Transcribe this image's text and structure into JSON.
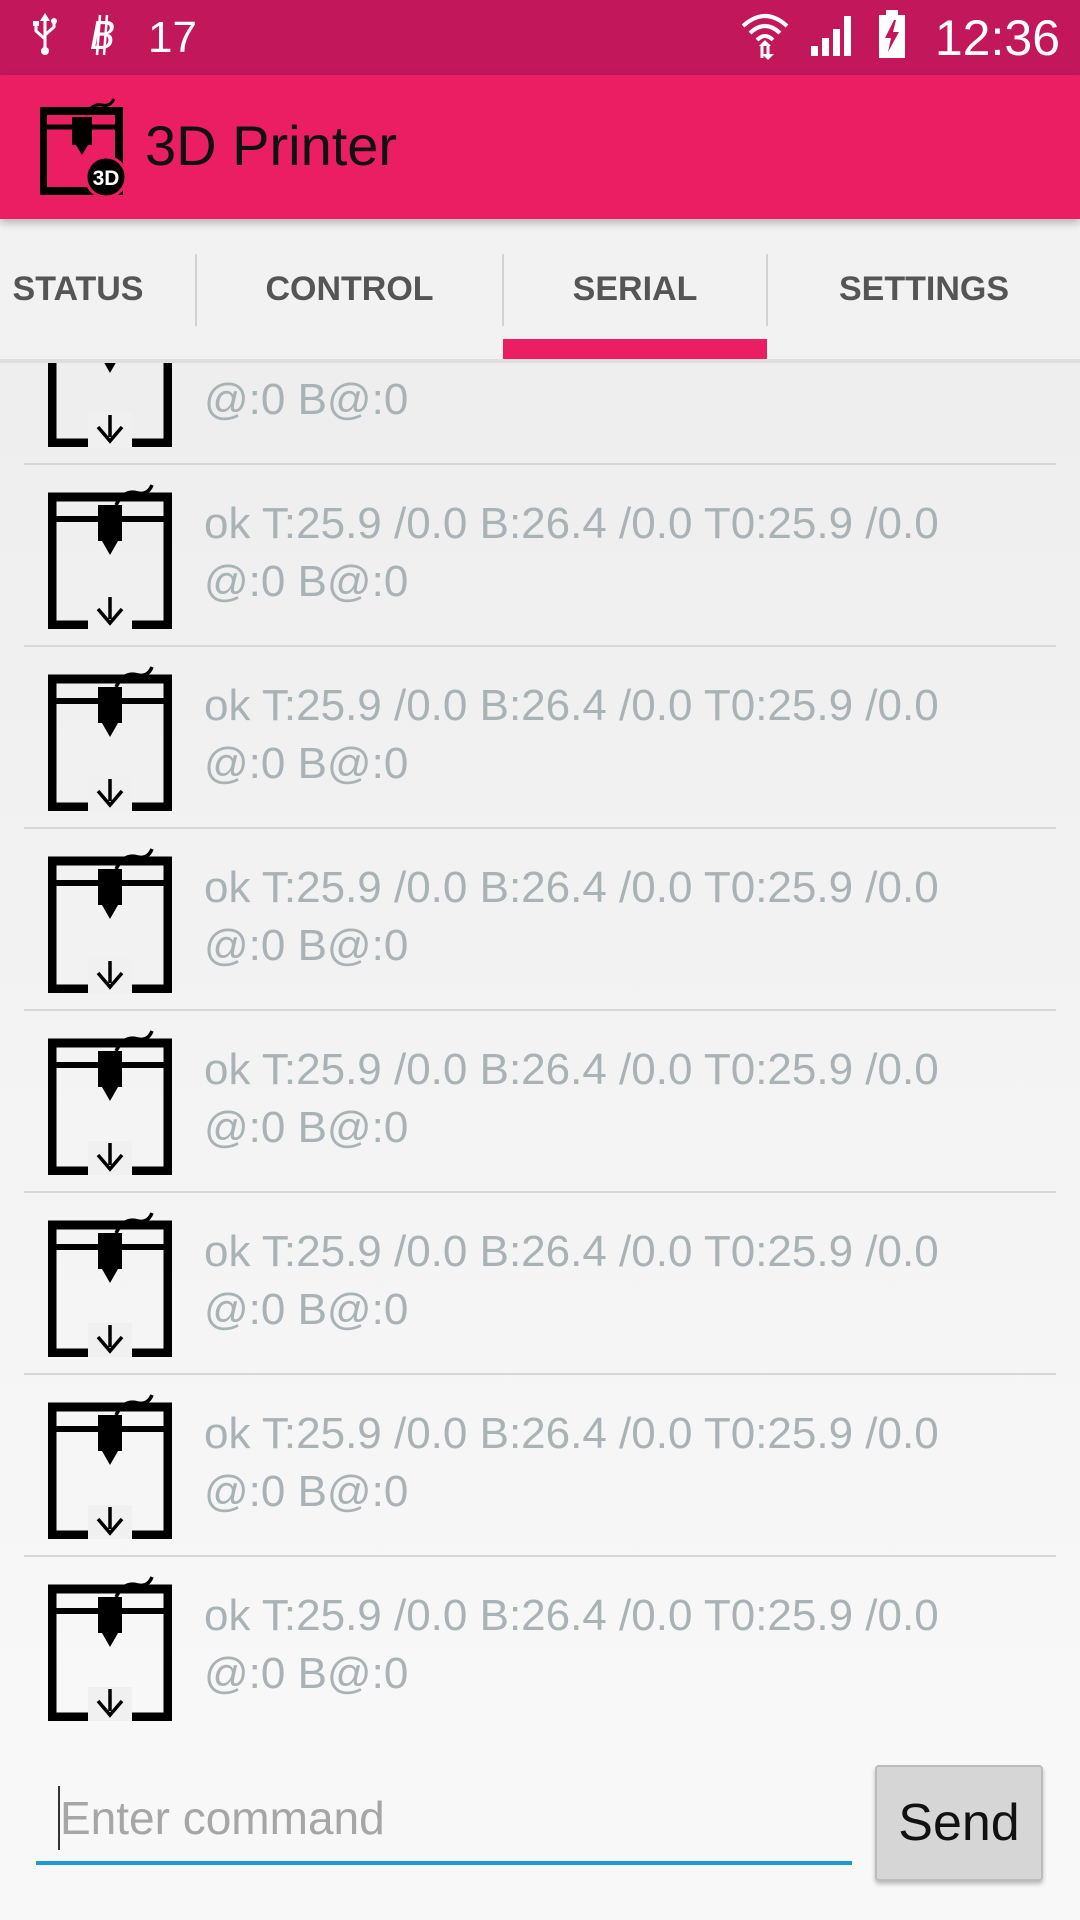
{
  "status_bar": {
    "notification_count": "17",
    "time": "12:36",
    "icons": [
      "usb-icon",
      "bitcoin-icon",
      "wifi-icon",
      "signal-icon",
      "battery-charging-icon"
    ]
  },
  "app_bar": {
    "title": "3D Printer",
    "logo_badge": "3D"
  },
  "tabs": [
    {
      "label": "STATUS"
    },
    {
      "label": "CONTROL"
    },
    {
      "label": "SERIAL"
    },
    {
      "label": "SETTINGS"
    }
  ],
  "active_tab": "SERIAL",
  "log": {
    "partial_first_line": "@:0 B@:0",
    "entries": [
      {
        "line1": "ok T:25.9 /0.0 B:26.4 /0.0 T0:25.9 /0.0",
        "line2": "@:0 B@:0"
      },
      {
        "line1": "ok T:25.9 /0.0 B:26.4 /0.0 T0:25.9 /0.0",
        "line2": "@:0 B@:0"
      },
      {
        "line1": "ok T:25.9 /0.0 B:26.4 /0.0 T0:25.9 /0.0",
        "line2": "@:0 B@:0"
      },
      {
        "line1": "ok T:25.9 /0.0 B:26.4 /0.0 T0:25.9 /0.0",
        "line2": "@:0 B@:0"
      },
      {
        "line1": "ok T:25.9 /0.0 B:26.4 /0.0 T0:25.9 /0.0",
        "line2": "@:0 B@:0"
      },
      {
        "line1": "ok T:25.9 /0.0 B:26.4 /0.0 T0:25.9 /0.0",
        "line2": "@:0 B@:0"
      },
      {
        "line1": "ok T:25.9 /0.0 B:26.4 /0.0 T0:25.9 /0.0",
        "line2": "@:0 B@:0"
      }
    ]
  },
  "command": {
    "placeholder": "Enter command",
    "value": "",
    "send_label": "Send"
  },
  "colors": {
    "status_bar": "#c2185b",
    "app_bar": "#ec1e63",
    "tab_indicator": "#ec1e63",
    "log_text": "#a9b2b5",
    "input_underline": "#1e9bd0"
  }
}
